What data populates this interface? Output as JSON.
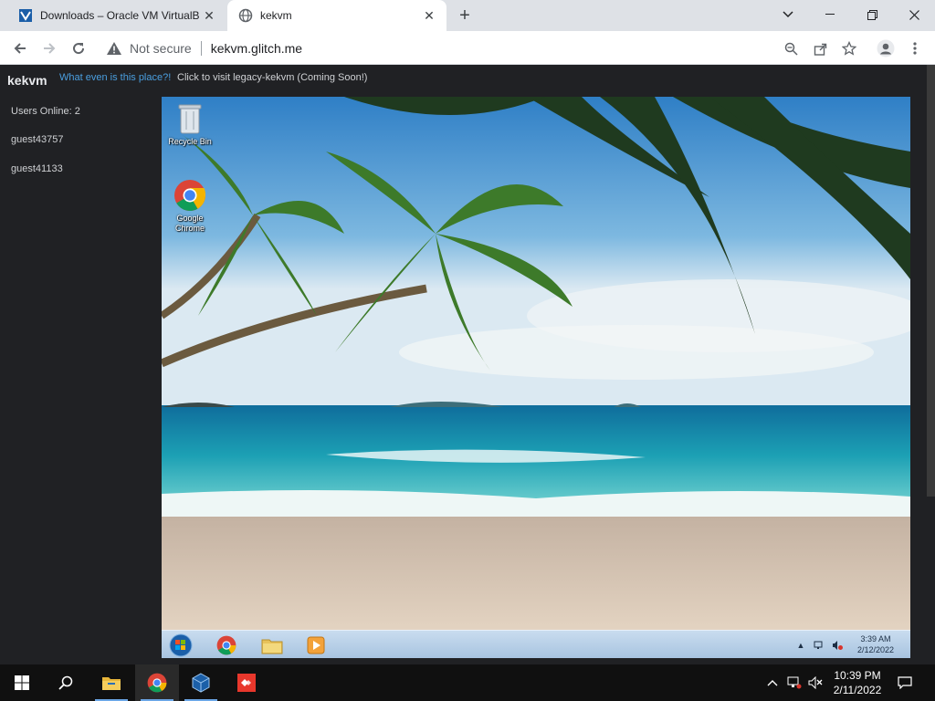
{
  "browser": {
    "tabs": [
      {
        "title": "Downloads – Oracle VM VirtualB",
        "favicon": "virtualbox-icon",
        "active": false
      },
      {
        "title": "kekvm",
        "favicon": "globe-icon",
        "active": true
      }
    ],
    "address": {
      "security_label": "Not secure",
      "url": "kekvm.glitch.me"
    }
  },
  "page": {
    "brand": "kekvm",
    "what_link": "What even is this place?!",
    "legacy_text": "Click to visit legacy-kekvm (Coming Soon!)",
    "users_online": "Users Online: 2",
    "users": [
      "guest43757",
      "guest41133"
    ]
  },
  "vm": {
    "desktop_icons": [
      {
        "label": "Recycle Bin",
        "icon": "recycle-bin-icon"
      },
      {
        "label": "Google Chrome",
        "icon": "chrome-icon"
      }
    ],
    "taskbar_apps": [
      "start-orb-icon",
      "chrome-icon",
      "file-explorer-icon",
      "media-player-icon"
    ],
    "clock_time": "3:39 AM",
    "clock_date": "2/12/2022"
  },
  "host_taskbar": {
    "apps": [
      "windows-start-icon",
      "search-icon",
      "file-explorer-icon",
      "chrome-icon",
      "virtualbox-icon",
      "anydesk-icon"
    ],
    "clock_time": "10:39 PM",
    "clock_date": "2/11/2022"
  },
  "colors": {
    "page_bg": "#202124",
    "link": "#4a9fe0",
    "tab_strip": "#dee1e6"
  }
}
